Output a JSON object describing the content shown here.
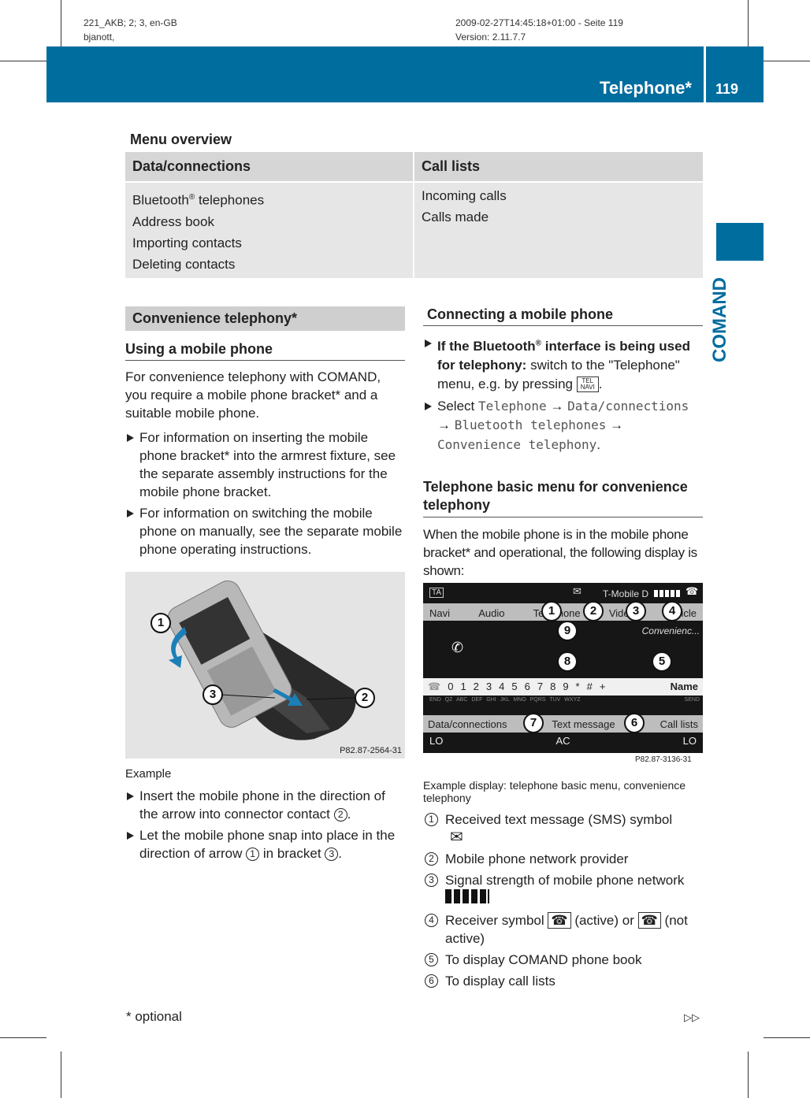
{
  "meta": {
    "left1": "221_AKB; 2; 3, en-GB",
    "left2": "bjanott,",
    "right1": "2009-02-27T14:45:18+01:00 - Seite 119",
    "right2": "Version: 2.11.7.7"
  },
  "header": {
    "title": "Telephone*",
    "page": "119",
    "side_tab": "COMAND",
    "brand_color": "#006d9f"
  },
  "menu_overview": {
    "title": "Menu overview",
    "columns": [
      {
        "heading": "Data/connections",
        "items": [
          "Bluetooth® telephones",
          "Address book",
          "Importing contacts",
          "Deleting contacts"
        ]
      },
      {
        "heading": "Call lists",
        "items": [
          "Incoming calls",
          "Calls made"
        ]
      }
    ]
  },
  "left": {
    "section": "Convenience telephony*",
    "heading": "Using a mobile phone",
    "intro": "For convenience telephony with COMAND, you require a mobile phone bracket* and a suitable mobile phone.",
    "bullets": [
      "For information on inserting the mobile phone bracket* into the armrest fixture, see the separate assembly instructions for the mobile phone bracket.",
      "For information on switching the mobile phone on manually, see the separate mobile phone operating instructions."
    ],
    "figure": {
      "code": "P82.87-2564-31",
      "callouts": [
        "1",
        "2",
        "3"
      ]
    },
    "caption": "Example",
    "steps": [
      {
        "text": "Insert the mobile phone in the direction of the arrow into connector contact",
        "ref": "2",
        "end": "."
      },
      {
        "text": "Let the mobile phone snap into place in the direction of arrow",
        "ref": "1",
        "mid": "in bracket",
        "ref2": "3",
        "end": "."
      }
    ]
  },
  "right": {
    "heading1": "Connecting a mobile phone",
    "step1": {
      "bold": "If the Bluetooth® interface is being used for telephony:",
      "text": "switch to the \"Telephone\" menu, e.g. by pressing",
      "key_top": "TEL",
      "key_bottom": "NAVI"
    },
    "step2": {
      "prefix": "Select",
      "path": [
        "Telephone",
        "Data/connections",
        "Bluetooth telephones",
        "Convenience telephony"
      ]
    },
    "heading2": "Telephone basic menu for convenience telephony",
    "intro": "When the mobile phone is in the mobile phone bracket* and operational, the following display is shown:",
    "display": {
      "provider": "T-Mobile D",
      "menu": [
        "Navi",
        "Audio",
        "Telephone",
        "Video",
        "Vehicle"
      ],
      "status": "Convenienc...",
      "digits": [
        "0",
        "1",
        "2",
        "3",
        "4",
        "5",
        "6",
        "7",
        "8",
        "9",
        "*",
        "#",
        "+"
      ],
      "letters": "END  QZ ABC DEF GHI JKL MNO PQRS TUV WXYZ",
      "send": "SEND",
      "name": "Name",
      "bottom": [
        "Data/connections",
        "Text message",
        "Call lists"
      ],
      "climate": [
        "LO",
        "AC",
        "LO"
      ],
      "code": "P82.87-3136-31"
    },
    "caption": "Example display: telephone basic menu, convenience telephony",
    "legend": [
      {
        "n": "1",
        "text": "Received text message (SMS) symbol"
      },
      {
        "n": "2",
        "text": "Mobile phone network provider"
      },
      {
        "n": "3",
        "text": "Signal strength of mobile phone network"
      },
      {
        "n": "4",
        "text": "Receiver symbol",
        "a": "(active) or",
        "b": "(not active)"
      },
      {
        "n": "5",
        "text": "To display COMAND phone book"
      },
      {
        "n": "6",
        "text": "To display call lists"
      }
    ]
  },
  "footer": {
    "note": "* optional",
    "continue": "▷▷"
  }
}
